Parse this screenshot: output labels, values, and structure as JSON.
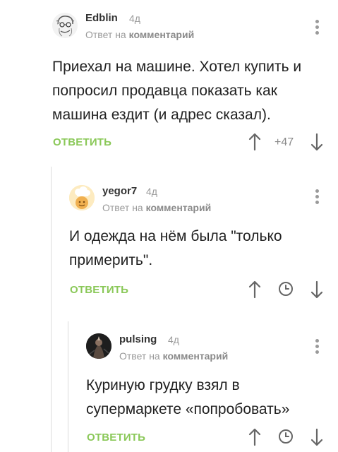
{
  "comments": [
    {
      "author": "Edblin",
      "time": "4д",
      "reply_prefix": "Ответ на",
      "reply_target": "комментарий",
      "text_lines": [
        "Приехал на машине. Хотел купить и",
        "попросил продавца показать как",
        "машина ездит (и адрес сказал)."
      ],
      "reply_label": "ОТВЕТИТЬ",
      "score": "+47",
      "avatar_icon": "sketch-face-avatar"
    },
    {
      "author": "yegor7",
      "time": "4д",
      "reply_prefix": "Ответ на",
      "reply_target": "комментарий",
      "text_lines": [
        "И одежда на нём была \"только",
        "примерить\"."
      ],
      "reply_label": "ОТВЕТИТЬ",
      "avatar_icon": "chef-avatar"
    },
    {
      "author": "pulsing",
      "time": "4д",
      "reply_prefix": "Ответ на",
      "reply_target": "комментарий",
      "text_lines": [
        "Куриную грудку взял в",
        "супермаркете «попробовать»"
      ],
      "reply_label": "ОТВЕТИТЬ",
      "avatar_icon": "dark-photo-avatar"
    }
  ],
  "colors": {
    "accent_green": "#8ac858",
    "meta_gray": "#9a9a9a",
    "text": "#222222"
  }
}
